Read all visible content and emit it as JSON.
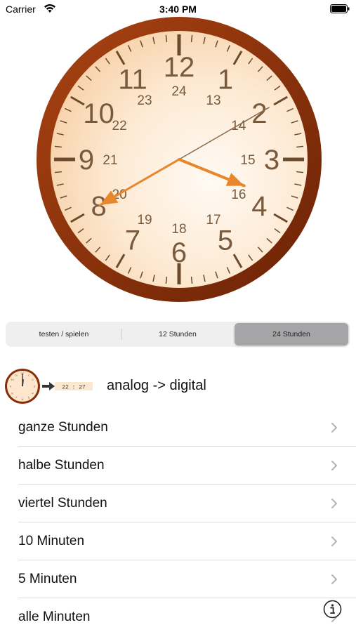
{
  "status_bar": {
    "carrier": "Carrier",
    "time": "3:40 PM"
  },
  "clock": {
    "hour_numbers": [
      "12",
      "1",
      "2",
      "3",
      "4",
      "5",
      "6",
      "7",
      "8",
      "9",
      "10",
      "11"
    ],
    "inner_numbers": [
      "24",
      "13",
      "14",
      "15",
      "16",
      "17",
      "18",
      "19",
      "20",
      "21",
      "22",
      "23"
    ],
    "hand_color": "#e8862c",
    "face_color": "#fde6cc",
    "rim_color": "#8a2e08",
    "number_color": "#7a5a3c"
  },
  "segmented_control": {
    "items": [
      "testen / spielen",
      "12 Stunden",
      "24 Stunden"
    ],
    "selected_index": 2
  },
  "mode": {
    "title": "analog -> digital",
    "thumbnail_digits": "22 : 27"
  },
  "list": {
    "items": [
      {
        "label": "ganze Stunden"
      },
      {
        "label": "halbe Stunden"
      },
      {
        "label": "viertel Stunden"
      },
      {
        "label": "10 Minuten"
      },
      {
        "label": "5 Minuten"
      },
      {
        "label": "alle Minuten"
      }
    ]
  }
}
